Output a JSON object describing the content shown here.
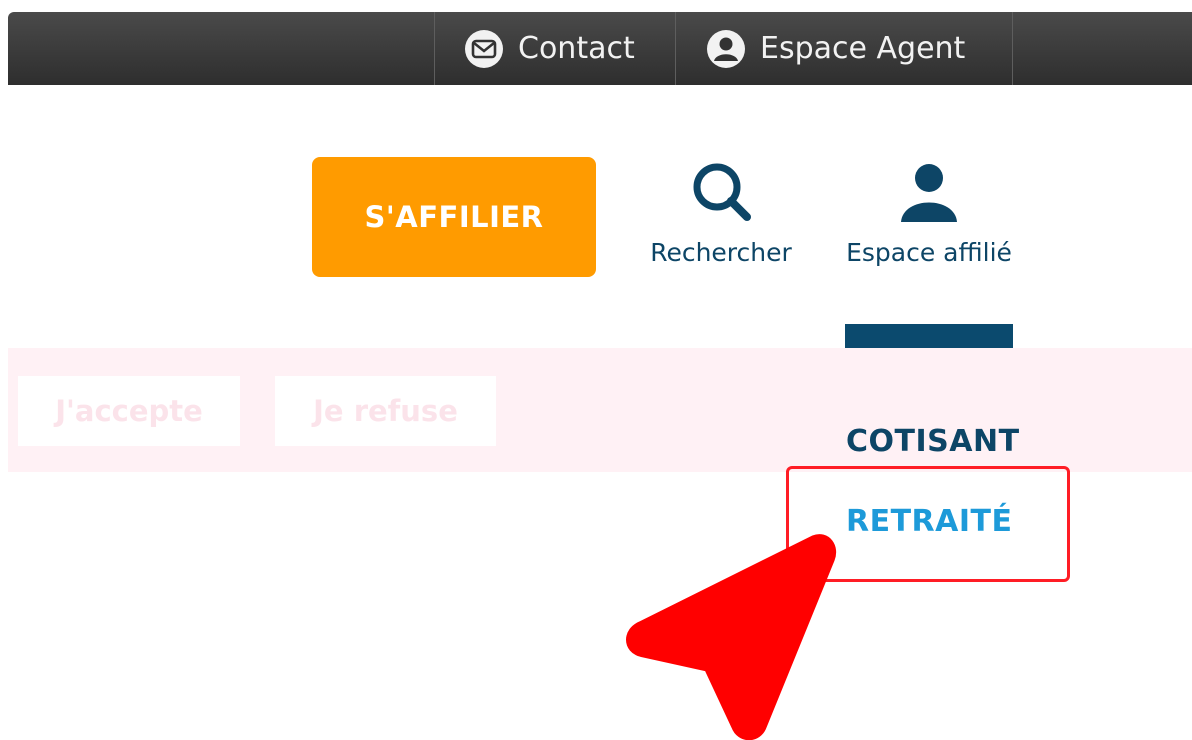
{
  "topbar": {
    "contact_label": "Contact",
    "agent_label": "Espace Agent"
  },
  "header": {
    "affilier_label": "S'AFFILIER",
    "search_label": "Rechercher",
    "affilie_label": "Espace affilié"
  },
  "cookie": {
    "accept_label": "J'accepte",
    "refuse_label": "Je refuse"
  },
  "menu": {
    "items": [
      {
        "label": "COTISANT",
        "color": "#0d4566"
      },
      {
        "label": "RETRAITÉ",
        "color": "#1d9ad9"
      }
    ]
  },
  "colors": {
    "brand_orange": "#ff9b00",
    "brand_blue": "#0d4566",
    "highlight_red": "#ff1d25"
  }
}
